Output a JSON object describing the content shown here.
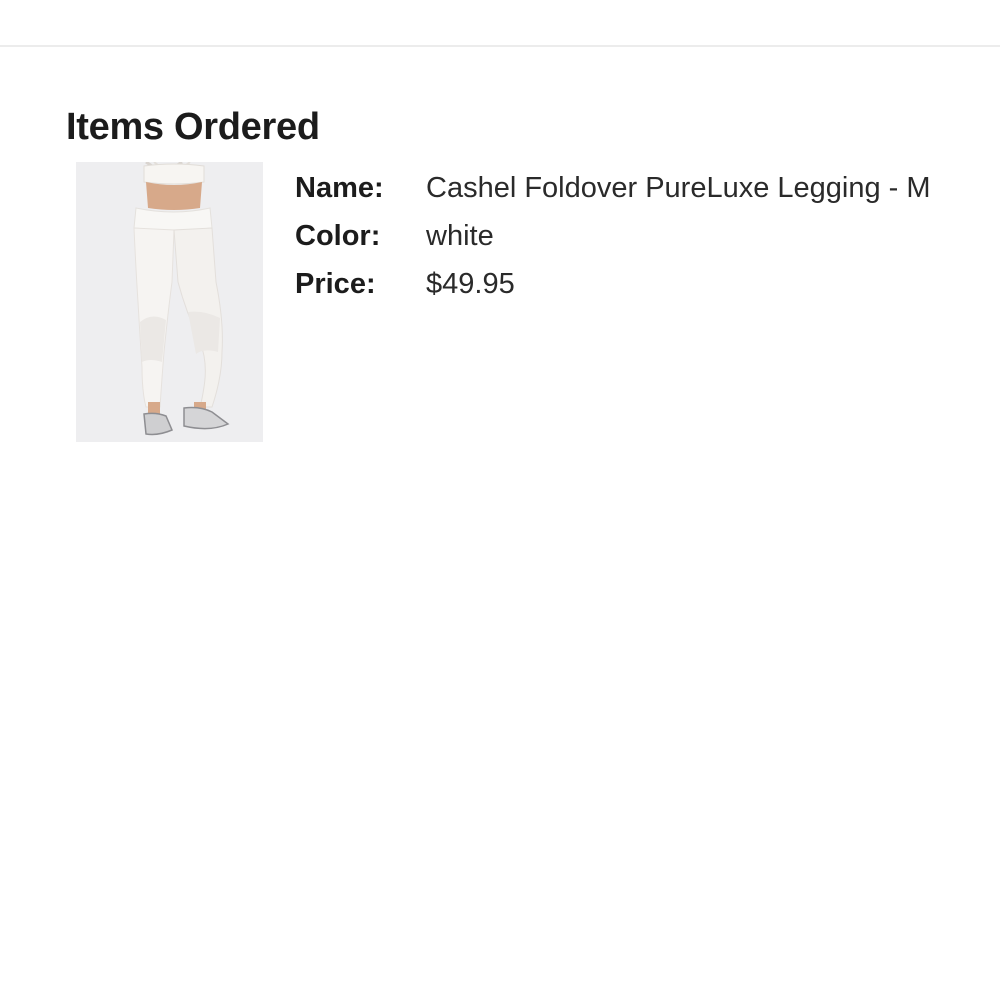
{
  "section": {
    "title": "Items Ordered"
  },
  "items": [
    {
      "image_icon": "product-photo-leggings",
      "name_label": "Name:",
      "name_value": "Cashel Foldover PureLuxe Legging - M",
      "color_label": "Color:",
      "color_value": "white",
      "price_label": "Price:",
      "price_value": "$49.95"
    }
  ]
}
